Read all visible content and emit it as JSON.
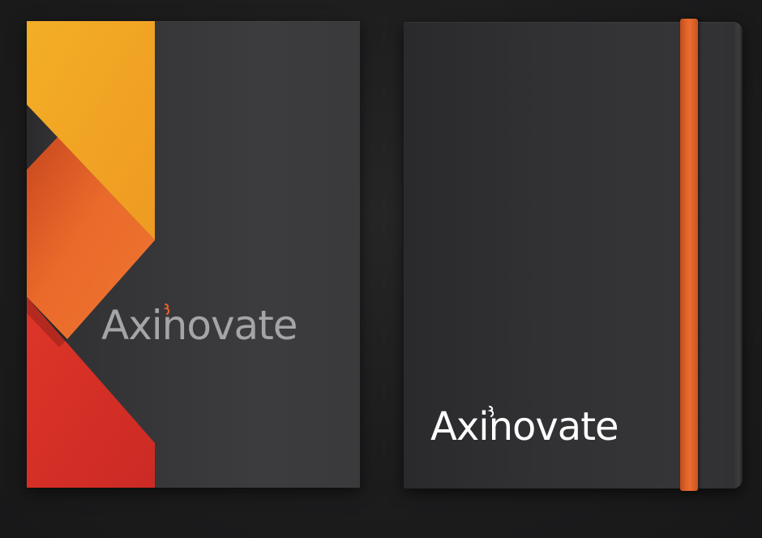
{
  "brand": {
    "name": "Axinovate"
  },
  "colors": {
    "background": "#1c1c1d",
    "cover": "#363638",
    "yellow": "#f2a623",
    "orange": "#e8622a",
    "red": "#d92f27",
    "strap": "#e2632a",
    "wordmark_folder": "#a5a5a7",
    "wordmark_notebook": "#ffffff"
  }
}
